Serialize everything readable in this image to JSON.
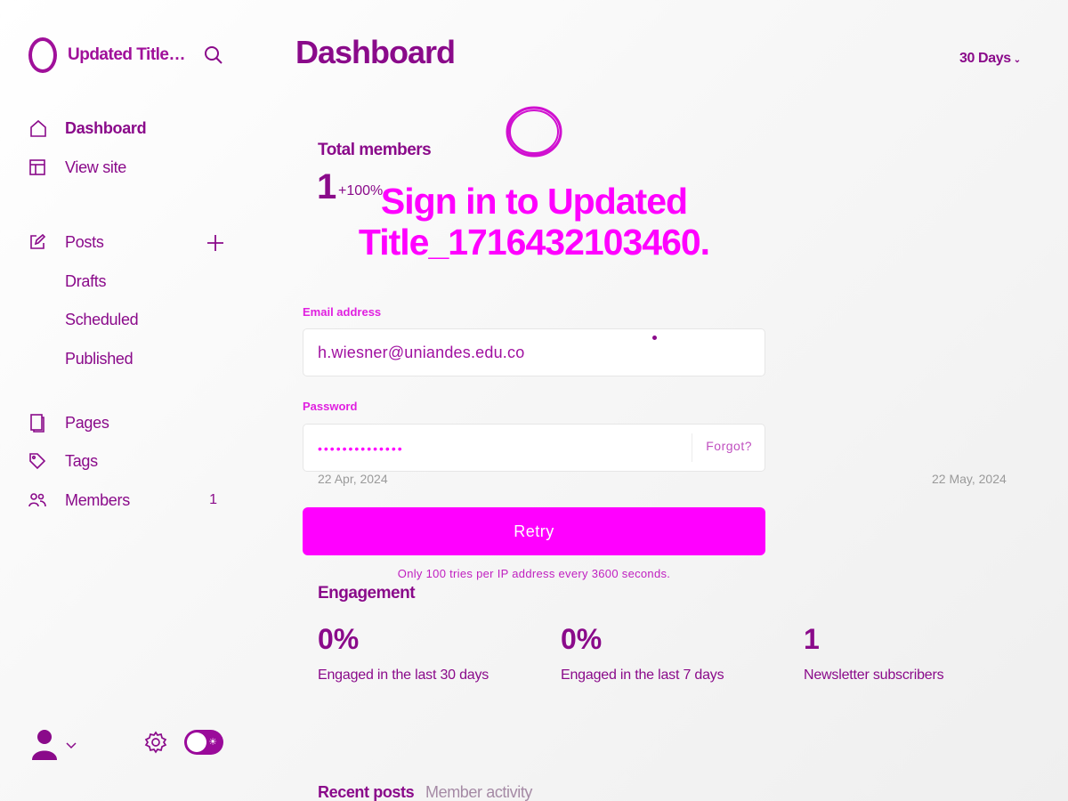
{
  "sidebar": {
    "site_title": "Updated Title_1716432103460",
    "items": [
      {
        "label": "Dashboard"
      },
      {
        "label": "View site"
      },
      {
        "label": "Posts"
      },
      {
        "label": "Drafts"
      },
      {
        "label": "Scheduled"
      },
      {
        "label": "Published"
      },
      {
        "label": "Pages"
      },
      {
        "label": "Tags"
      },
      {
        "label": "Members",
        "count": "1"
      }
    ]
  },
  "header": {
    "title": "Dashboard",
    "range": "30 Days"
  },
  "members": {
    "label": "Total members",
    "value": "1",
    "delta": "+100%",
    "date_start": "22 Apr, 2024",
    "date_end": "22 May, 2024"
  },
  "engagement": {
    "title": "Engagement",
    "stats": [
      {
        "value": "0%",
        "label": "Engaged in the last 30 days"
      },
      {
        "value": "0%",
        "label": "Engaged in the last 7 days"
      },
      {
        "value": "1",
        "label": "Newsletter subscribers"
      }
    ]
  },
  "tabs": [
    {
      "label": "Recent posts"
    },
    {
      "label": "Member activity"
    }
  ],
  "signin": {
    "title": "Sign in to Updated Title_1716432103460.",
    "email_label": "Email address",
    "email_value": "h.wiesner@uniandes.edu.co",
    "password_label": "Password",
    "password_mask": "••••••••••••••",
    "forgot_label": "Forgot?",
    "retry_label": "Retry",
    "rate_limit_message": "Only 100 tries per IP address every 3600 seconds."
  },
  "colors": {
    "accent": "#ff00ff",
    "text": "#8a0a8a",
    "muted": "#9a9a9a"
  },
  "icons": [
    "brand-logo-icon",
    "search-icon",
    "home-icon",
    "view-site-icon",
    "posts-icon",
    "plus-icon",
    "pages-icon",
    "tags-icon",
    "members-icon",
    "avatar-icon",
    "chevron-down-icon",
    "gear-icon",
    "theme-toggle"
  ]
}
